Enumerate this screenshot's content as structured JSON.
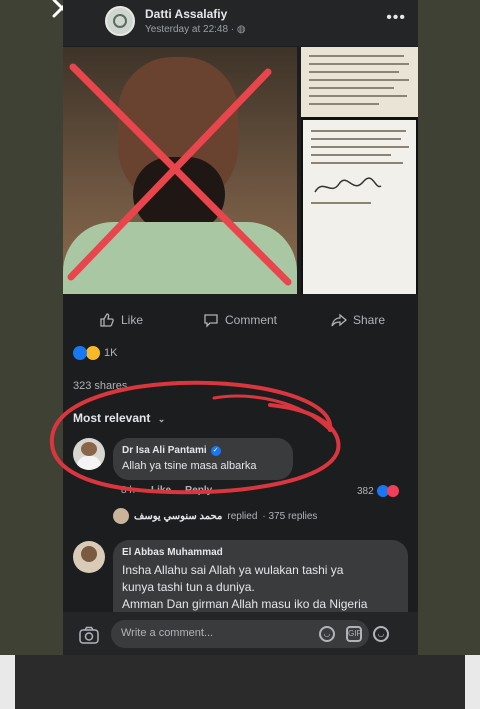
{
  "post": {
    "author": "Datti Assalafiy",
    "time": "Yesterday at 22:48 · ",
    "more": "•••"
  },
  "actions": {
    "like": "Like",
    "comment": "Comment",
    "share": "Share"
  },
  "engagement": {
    "reaction_count": "1K",
    "shares": "323 shares"
  },
  "comments": {
    "sort_label": "Most relevant",
    "items": [
      {
        "name": "Dr Isa Ali Pantami",
        "text": "Allah ya tsine masa albarka",
        "age": "8 h",
        "like": "Like",
        "reply": "Reply",
        "reaction_count": "382"
      },
      {
        "name": "El Abbas Muhammad",
        "text_lines": [
          "Insha Allahu sai Allah ya wulakan tashi  ya",
          "kunya tashi tun a duniya.",
          "Amman Dan girman Allah masu iko da Nigeria"
        ]
      }
    ],
    "replies_summary": {
      "replier": "محمد سنوسي يوسف",
      "replied": "replied",
      "count": "· 375 replies"
    }
  },
  "composer": {
    "placeholder": "Write a comment..."
  },
  "colors": {
    "annotation": "#d9363e",
    "facebook_blue": "#1877f2"
  }
}
